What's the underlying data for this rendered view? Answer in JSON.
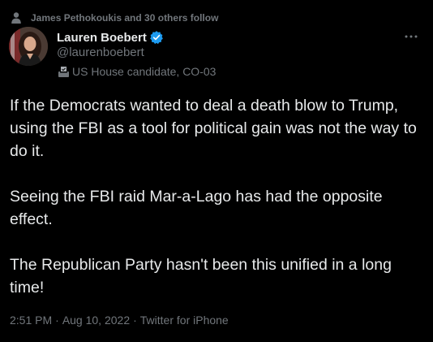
{
  "social_context": {
    "icon": "person-icon",
    "text": "James Pethokoukis and 30 others follow"
  },
  "author": {
    "avatar_icon": "avatar",
    "name": "Lauren Boebert",
    "verified_icon": "verified-badge-icon",
    "handle": "@laurenboebert",
    "label_icon": "ballot-box-icon",
    "label": "US House candidate, CO-03"
  },
  "more_icon": "more-options-icon",
  "tweet": {
    "paragraphs": [
      "If the Democrats wanted to deal a death blow to Trump, using the FBI as a tool for political gain was not the way to do it.",
      "Seeing the FBI raid Mar-a-Lago has had the opposite effect.",
      "The Republican Party hasn't been this unified in a long time!"
    ],
    "time": "2:51 PM",
    "separator": "·",
    "date": "Aug 10, 2022",
    "source": "Twitter for iPhone"
  },
  "colors": {
    "background": "#000000",
    "text_primary": "#e7e9ea",
    "text_secondary": "#71767b",
    "verified": "#1d9bf0"
  }
}
